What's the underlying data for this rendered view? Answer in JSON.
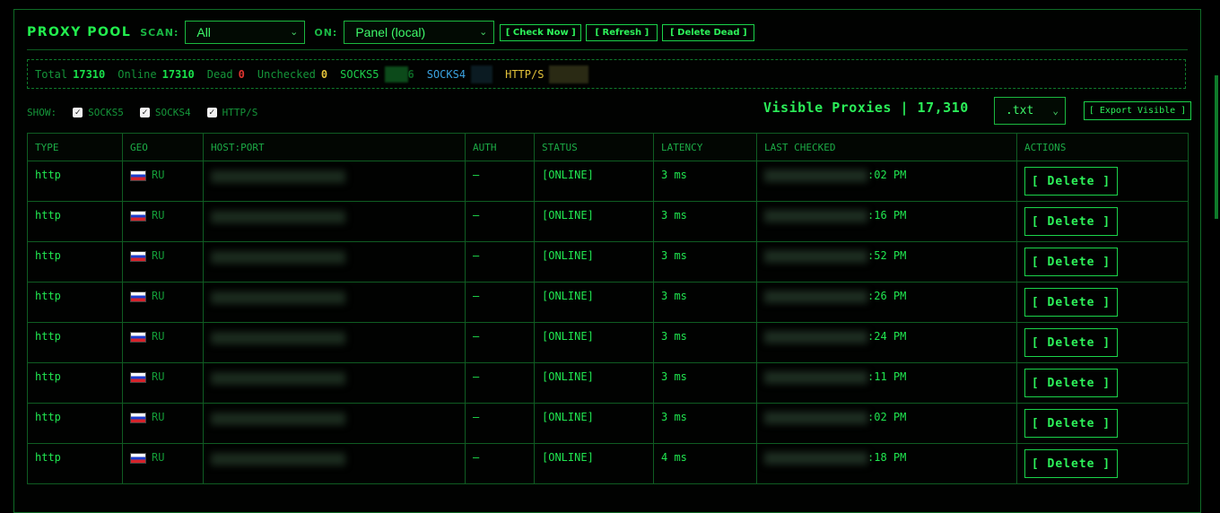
{
  "header": {
    "title": "PROXY POOL",
    "scan_label": "SCAN:",
    "scan_value": "All",
    "on_label": "ON:",
    "on_value": "Panel (local)",
    "buttons": {
      "check_now": "[ Check Now ]",
      "refresh": "[ Refresh ]",
      "delete_dead": "[ Delete Dead ]"
    }
  },
  "stats": {
    "total_label": "Total",
    "total": "17310",
    "online_label": "Online",
    "online": "17310",
    "dead_label": "Dead",
    "dead": "0",
    "unchecked_label": "Unchecked",
    "unchecked": "0",
    "socks5_label": "SOCKS5",
    "socks5_tail": "6",
    "socks4_label": "SOCKS4",
    "https_label": "HTTP/S"
  },
  "filters": {
    "show_label": "SHOW:",
    "options": [
      "SOCKS5",
      "SOCKS4",
      "HTTP/S"
    ]
  },
  "visible": {
    "text": "Visible Proxies | 17,310",
    "format": ".txt",
    "export_label": "[ Export Visible ]"
  },
  "table": {
    "headers": [
      "TYPE",
      "GEO",
      "HOST:PORT",
      "AUTH",
      "STATUS",
      "LATENCY",
      "LAST CHECKED",
      "ACTIONS"
    ],
    "delete_label": "[ Delete ]",
    "rows": [
      {
        "type": "http",
        "geo": "RU",
        "auth": "–",
        "status": "[ONLINE]",
        "latency": "3 ms",
        "time_suffix": ":02 PM"
      },
      {
        "type": "http",
        "geo": "RU",
        "auth": "–",
        "status": "[ONLINE]",
        "latency": "3 ms",
        "time_suffix": ":16 PM"
      },
      {
        "type": "http",
        "geo": "RU",
        "auth": "–",
        "status": "[ONLINE]",
        "latency": "3 ms",
        "time_suffix": ":52 PM"
      },
      {
        "type": "http",
        "geo": "RU",
        "auth": "–",
        "status": "[ONLINE]",
        "latency": "3 ms",
        "time_suffix": ":26 PM"
      },
      {
        "type": "http",
        "geo": "RU",
        "auth": "–",
        "status": "[ONLINE]",
        "latency": "3 ms",
        "time_suffix": ":24 PM"
      },
      {
        "type": "http",
        "geo": "RU",
        "auth": "–",
        "status": "[ONLINE]",
        "latency": "3 ms",
        "time_suffix": ":11 PM"
      },
      {
        "type": "http",
        "geo": "RU",
        "auth": "–",
        "status": "[ONLINE]",
        "latency": "3 ms",
        "time_suffix": ":02 PM"
      },
      {
        "type": "http",
        "geo": "RU",
        "auth": "–",
        "status": "[ONLINE]",
        "latency": "4 ms",
        "time_suffix": ":18 PM"
      }
    ]
  },
  "colors": {
    "accent": "#19e04a",
    "dead": "#e0342f",
    "unchecked": "#e3c23a",
    "socks4": "#3aa2e0",
    "https": "#e3c23a"
  }
}
